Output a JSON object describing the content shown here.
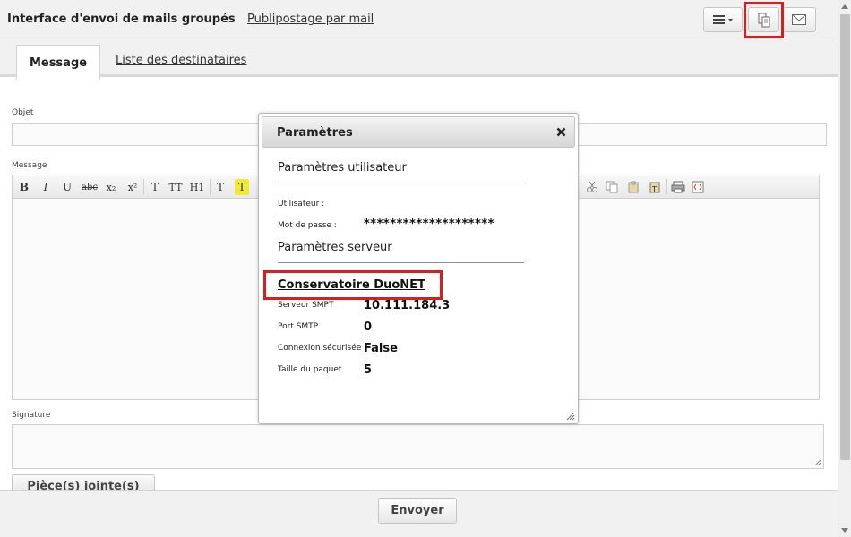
{
  "header": {
    "title": "Interface d'envoi de mails groupés",
    "link": "Publipostage par mail",
    "buttons": [
      {
        "icon": "menu-icon"
      },
      {
        "icon": "copy-icon"
      },
      {
        "icon": "mail-icon"
      }
    ]
  },
  "tabs": [
    {
      "label": "Message"
    },
    {
      "label": "Liste des destinataires"
    }
  ],
  "form": {
    "subject_label": "Objet",
    "message_label": "Message",
    "signature_label": "Signature",
    "attachments_label": "Pièce(s) jointe(s)"
  },
  "editor": {
    "toolbar": [
      "B",
      "I",
      "U",
      "abc",
      "x₂",
      "x²",
      "T",
      "TT",
      "H1",
      "T",
      "T"
    ]
  },
  "modal": {
    "title": "Paramètres",
    "user_section": "Paramètres utilisateur",
    "user_label": "Utilisateur :",
    "password_label": "Mot de passe :",
    "password_value": "********************",
    "server_section": "Paramètres serveur",
    "server_name": "Conservatoire DuoNET",
    "smtp_server_label": "Serveur SMPT",
    "smtp_server_value": "10.111.184.3",
    "smtp_port_label": "Port SMTP",
    "smtp_port_value": "0",
    "secure_label": "Connexion sécurisée",
    "secure_value": "False",
    "packet_label": "Taille du paquet",
    "packet_value": "5"
  },
  "footer": {
    "send_label": "Envoyer"
  },
  "colors": {
    "highlight": "#d81f1f"
  }
}
